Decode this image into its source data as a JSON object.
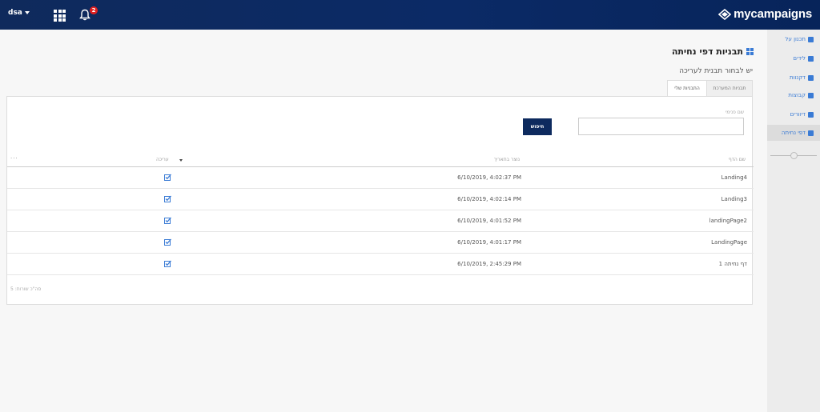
{
  "header": {
    "user": "dsa",
    "notifications_count": "2",
    "logo_text": "mycampaigns",
    "icons": [
      "apps-grid-icon",
      "bell-icon",
      "logo-icon"
    ]
  },
  "sidebar": {
    "items": [
      {
        "label": "תכנון על",
        "icon": "chart-icon"
      },
      {
        "label": "לידים",
        "icon": "megaphone-icon"
      },
      {
        "label": "דקנוות",
        "icon": "document-icon"
      },
      {
        "label": "קבוצות",
        "icon": "users-icon"
      },
      {
        "label": "דיוורים",
        "icon": "send-icon"
      },
      {
        "label": "דפי נחיתה",
        "icon": "pages-icon",
        "active": true
      }
    ]
  },
  "page": {
    "title": "תבניות דפי נחיתה",
    "subtitle": "יש לבחור תבנית לעריכה",
    "tabs": [
      {
        "label": "התבניות שלי",
        "active": true
      },
      {
        "label": "תבניות המערכת",
        "active": false
      }
    ]
  },
  "filter": {
    "page_name_label": "שם פנימי",
    "page_name_value": "",
    "search_label": "חיפוש"
  },
  "table": {
    "columns": {
      "name": "שם הדף",
      "date": "נוצר בתאריך",
      "edit": "עריכה",
      "more": "..."
    },
    "rows": [
      {
        "name": "Landing4",
        "date": "6/10/2019, 4:02:37 PM"
      },
      {
        "name": "Landing3",
        "date": "6/10/2019, 4:02:14 PM"
      },
      {
        "name": "landingPage2",
        "date": "6/10/2019, 4:01:52 PM"
      },
      {
        "name": "LandingPage",
        "date": "6/10/2019, 4:01:17 PM"
      },
      {
        "name": "דף נחיתה 1",
        "date": "6/10/2019, 2:45:29 PM"
      }
    ],
    "total_rows": "סה\"כ שורות: 5"
  },
  "colors": {
    "header_bg": "#0b2a66",
    "accent": "#3a7bd5",
    "button_bg": "#0d2a5e",
    "badge": "#e02020"
  }
}
